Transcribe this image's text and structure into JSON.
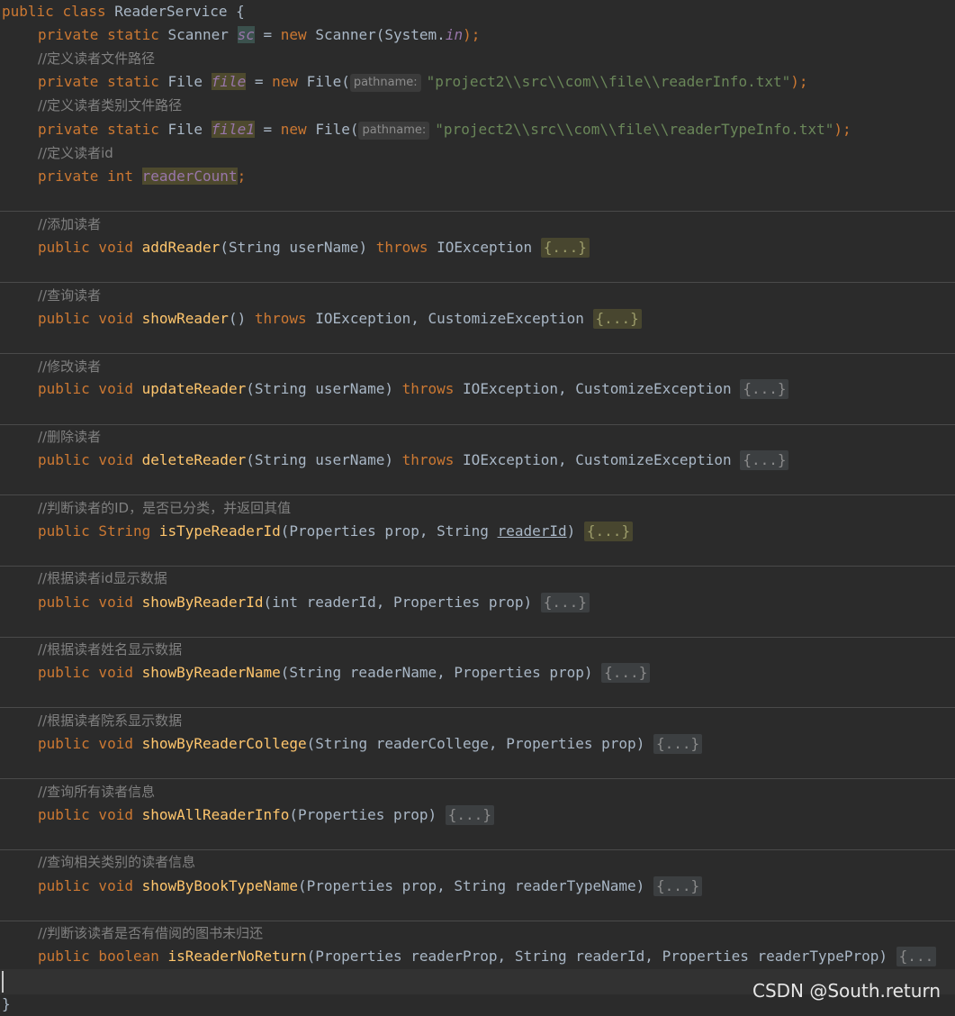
{
  "code": {
    "class_decl": {
      "kw1": "public",
      "kw2": "class",
      "name": "ReaderService",
      "brace": "{"
    },
    "sc_line": {
      "mods": "private static",
      "type": "Scanner",
      "var": "sc",
      "eq": "=",
      "new": "new",
      "ctor": "Scanner(System.",
      "in": "in",
      "end": ");"
    },
    "comment_file": "//定义读者文件路径",
    "file_line": {
      "mods": "private static",
      "type": "File",
      "var": "file",
      "eq": "=",
      "new": "new",
      "ctor": "File(",
      "hint": "pathname:",
      "str": "\"project2\\\\src\\\\com\\\\file\\\\readerInfo.txt\"",
      "end": ");"
    },
    "comment_file1": "//定义读者类别文件路径",
    "file1_line": {
      "mods": "private static",
      "type": "File",
      "var": "file1",
      "eq": "=",
      "new": "new",
      "ctor": "File(",
      "hint": "pathname:",
      "str": "\"project2\\\\src\\\\com\\\\file\\\\readerTypeInfo.txt\"",
      "end": ");"
    },
    "comment_id": "//定义读者id",
    "count_line": {
      "mods": "private int",
      "var": "readerCount",
      "end": ";"
    },
    "methods": [
      {
        "comment": "//添加读者",
        "mods": "public void",
        "name": "addReader",
        "params": "(String userName)",
        "throws": "throws",
        "ex": "IOException",
        "fold": "{...}"
      },
      {
        "comment": "//查询读者",
        "mods": "public void",
        "name": "showReader",
        "params": "()",
        "throws": "throws",
        "ex": "IOException, CustomizeException",
        "fold": "{...}"
      },
      {
        "comment": "//修改读者",
        "mods": "public void",
        "name": "updateReader",
        "params": "(String userName)",
        "throws": "throws",
        "ex": "IOException, CustomizeException",
        "fold": "{...}"
      },
      {
        "comment": "//删除读者",
        "mods": "public void",
        "name": "deleteReader",
        "params": "(String userName)",
        "throws": "throws",
        "ex": "IOException, CustomizeException",
        "fold": "{...}"
      },
      {
        "comment": "//判断读者的ID，是否已分类，并返回其值",
        "mods": "public String",
        "name": "isTypeReaderId",
        "params": "(Properties prop, String ",
        "param_u": "readerId",
        "params_end": ")",
        "fold": "{...}"
      },
      {
        "comment": "//根据读者id显示数据",
        "mods": "public void",
        "name": "showByReaderId",
        "params": "(int readerId, Properties prop)",
        "fold": "{...}"
      },
      {
        "comment": "//根据读者姓名显示数据",
        "mods": "public void",
        "name": "showByReaderName",
        "params": "(String readerName, Properties prop)",
        "fold": "{...}"
      },
      {
        "comment": "//根据读者院系显示数据",
        "mods": "public void",
        "name": "showByReaderCollege",
        "params": "(String readerCollege, Properties prop)",
        "fold": "{...}"
      },
      {
        "comment": "//查询所有读者信息",
        "mods": "public void",
        "name": "showAllReaderInfo",
        "params": "(Properties prop)",
        "fold": "{...}"
      },
      {
        "comment": "//查询相关类别的读者信息",
        "mods": "public void",
        "name": "showByBookTypeName",
        "params": "(Properties prop, String readerTypeName)",
        "fold": "{...}"
      },
      {
        "comment": "//判断该读者是否有借阅的图书未归还",
        "mods": "public boolean",
        "name": "isReaderNoReturn",
        "params": "(Properties readerProp, String readerId, Properties readerTypeProp)",
        "fold": "{..."
      }
    ],
    "closing_brace": "}"
  },
  "watermark": "CSDN @South.return"
}
